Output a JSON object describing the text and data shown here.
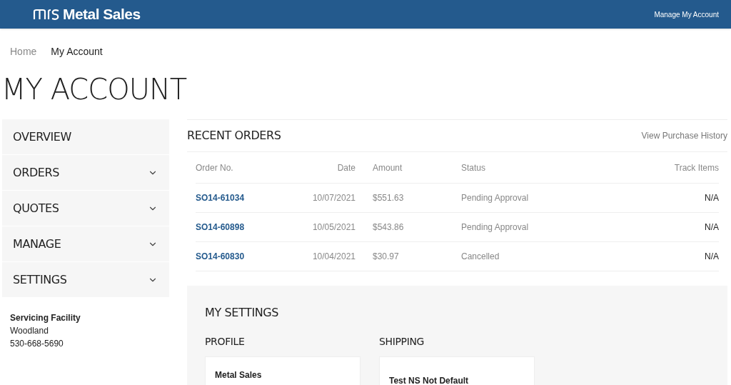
{
  "header": {
    "brand": "Metal Sales",
    "account_link": "Manage My Account"
  },
  "breadcrumb": [
    {
      "label": "Home",
      "current": false
    },
    {
      "label": "My Account",
      "current": true
    }
  ],
  "page_title": "MY ACCOUNT",
  "sidebar": {
    "items": [
      {
        "label": "OVERVIEW",
        "kind": "link"
      },
      {
        "label": "ORDERS",
        "kind": "expandable"
      },
      {
        "label": "QUOTES",
        "kind": "expandable"
      },
      {
        "label": "MANAGE",
        "kind": "expandable"
      },
      {
        "label": "SETTINGS",
        "kind": "expandable"
      }
    ],
    "facility": {
      "heading": "Servicing Facility",
      "name": "Woodland",
      "phone": "530-668-5690"
    }
  },
  "recent_orders": {
    "title": "RECENT ORDERS",
    "history_link": "View Purchase History",
    "columns": [
      "Order No.",
      "Date",
      "Amount",
      "Status",
      "Track Items"
    ],
    "rows": [
      {
        "order": "SO14-61034",
        "date": "10/07/2021",
        "amount": "$551.63",
        "status": "Pending Approval",
        "track": "N/A"
      },
      {
        "order": "SO14-60898",
        "date": "10/05/2021",
        "amount": "$543.86",
        "status": "Pending Approval",
        "track": "N/A"
      },
      {
        "order": "SO14-60830",
        "date": "10/04/2021",
        "amount": "$30.97",
        "status": "Cancelled",
        "track": "N/A"
      }
    ]
  },
  "my_settings": {
    "title": "MY SETTINGS",
    "sections": [
      {
        "title": "PROFILE",
        "card_title": "Metal Sales"
      },
      {
        "title": "SHIPPING",
        "card_title": "Test NS Not Default"
      }
    ]
  }
}
